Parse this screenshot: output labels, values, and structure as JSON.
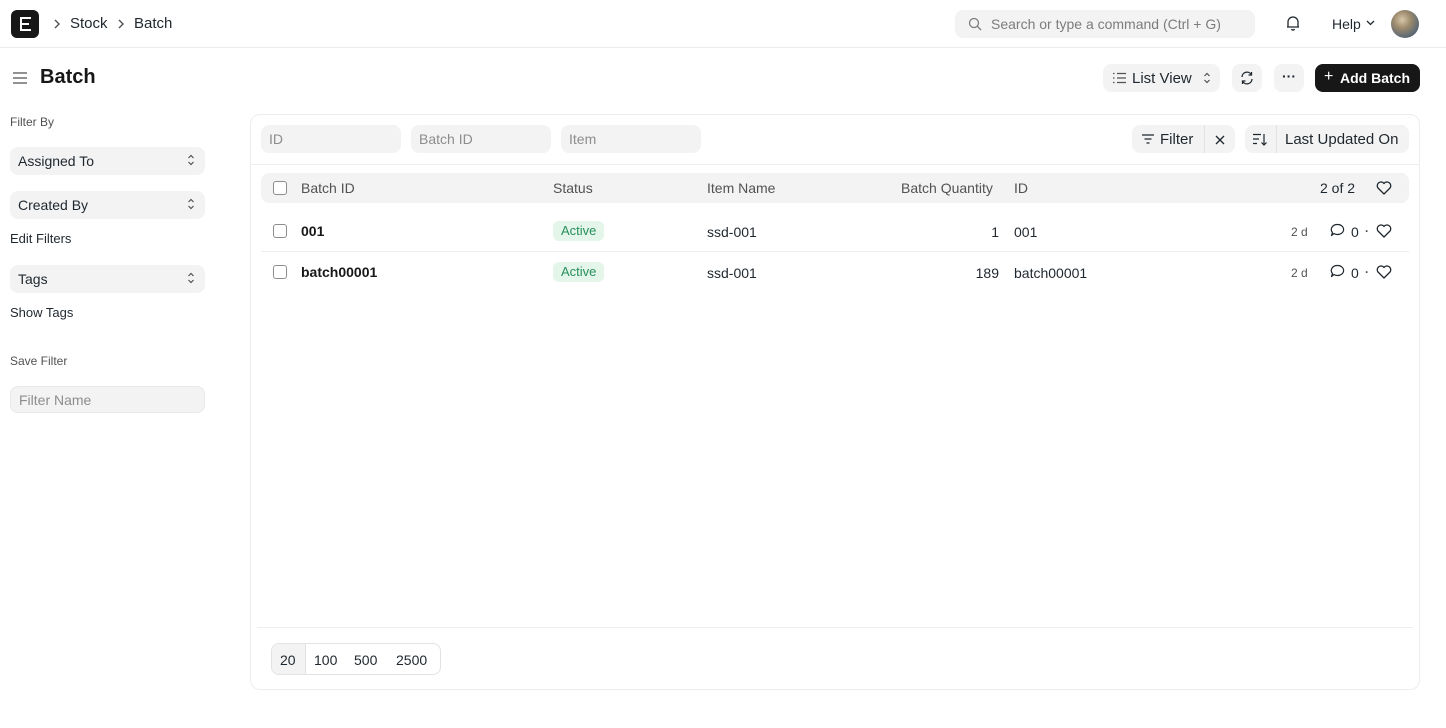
{
  "navbar": {
    "breadcrumbs": [
      "Stock",
      "Batch"
    ],
    "search_placeholder": "Search or type a command (Ctrl + G)",
    "help_label": "Help"
  },
  "page": {
    "title": "Batch",
    "view_switcher": "List View",
    "more_label": "···",
    "add_button": "Add Batch",
    "add_icon": "+"
  },
  "sidebar": {
    "filter_by_label": "Filter By",
    "assigned_to": "Assigned To",
    "created_by": "Created By",
    "edit_filters": "Edit Filters",
    "tags": "Tags",
    "show_tags": "Show Tags",
    "save_filter_label": "Save Filter",
    "filter_name_placeholder": "Filter Name"
  },
  "filters": {
    "id_placeholder": "ID",
    "batch_id_placeholder": "Batch ID",
    "item_placeholder": "Item",
    "filter_button": "Filter",
    "sort_label": "Last Updated On"
  },
  "table": {
    "columns": [
      "Batch ID",
      "Status",
      "Item Name",
      "Batch Quantity",
      "ID"
    ],
    "count": "2 of 2",
    "rows": [
      {
        "batch_id": "001",
        "status": "Active",
        "item_name": "ssd-001",
        "quantity": "1",
        "id": "001",
        "modified": "2 d",
        "comments": "0"
      },
      {
        "batch_id": "batch00001",
        "status": "Active",
        "item_name": "ssd-001",
        "quantity": "189",
        "id": "batch00001",
        "modified": "2 d",
        "comments": "0"
      }
    ]
  },
  "pagination": {
    "sizes": [
      "20",
      "100",
      "500",
      "2500"
    ]
  },
  "colors": {
    "primary_button": "#171717",
    "active_badge_bg": "#e4f5e9",
    "active_badge_text": "#278f5e"
  }
}
